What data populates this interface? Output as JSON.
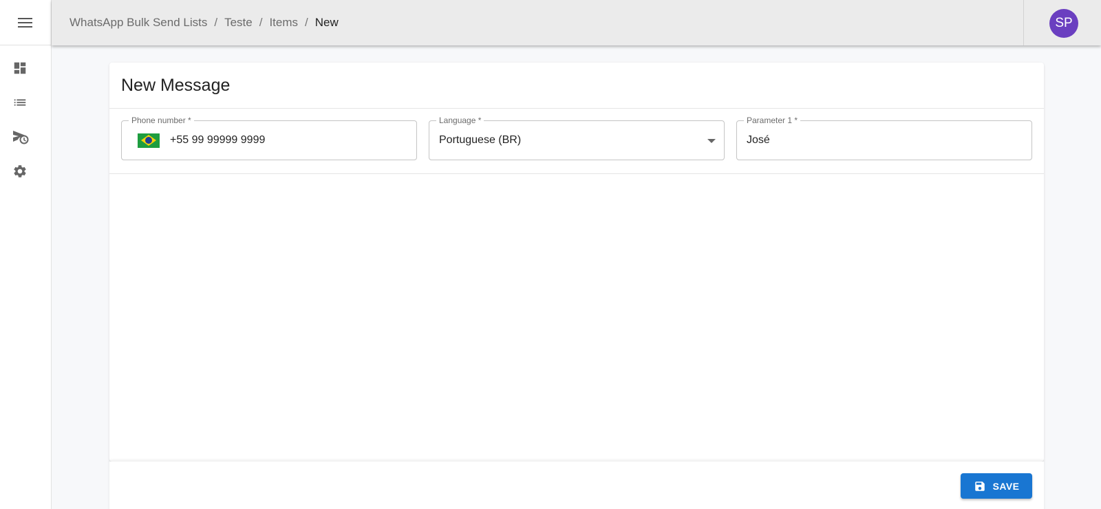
{
  "sidebar": {
    "menu_icon": "hamburger-menu-icon",
    "items": [
      {
        "icon": "dashboard-icon"
      },
      {
        "icon": "list-icon"
      },
      {
        "icon": "scheduled-send-icon"
      },
      {
        "icon": "gear-icon"
      }
    ]
  },
  "header": {
    "breadcrumb": [
      "WhatsApp Bulk Send Lists",
      "Teste",
      "Items",
      "New"
    ],
    "separator": "/",
    "avatar_initials": "SP",
    "avatar_color": "#6a3fc0"
  },
  "form": {
    "title": "New Message",
    "phone": {
      "label": "Phone number *",
      "value": "+55 99 99999 9999",
      "country_icon": "brazil-flag-icon"
    },
    "language": {
      "label": "Language *",
      "selected": "Portuguese (BR)"
    },
    "parameter1": {
      "label": "Parameter 1 *",
      "value": "José"
    }
  },
  "footer": {
    "save_label": "SAVE",
    "save_icon": "floppy-disk-icon",
    "accent_color": "#1976d2"
  }
}
